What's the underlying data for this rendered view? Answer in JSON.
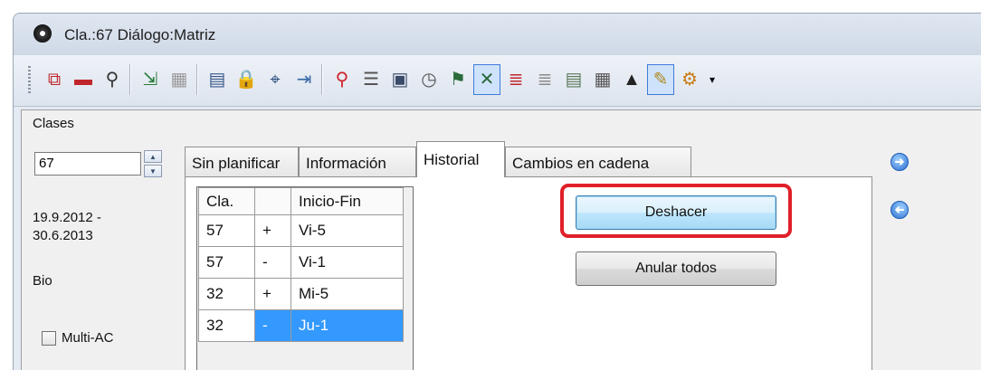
{
  "window": {
    "title": "Cla.:67  Diálogo:Matriz"
  },
  "toolbar": {
    "icons": [
      {
        "name": "copy-lesson-icon",
        "glyph": "⧉",
        "color": "#c0262b"
      },
      {
        "name": "lesson-icon",
        "glyph": "▬",
        "color": "#c0262b"
      },
      {
        "name": "split-icon",
        "glyph": "⚲",
        "color": "#333333"
      },
      {
        "name": "import-icon",
        "glyph": "⇲",
        "color": "#2a7a3b"
      },
      {
        "name": "grid-gray-icon",
        "glyph": "▦",
        "color": "#9a9a9a"
      },
      {
        "name": "teacher-icon",
        "glyph": "▤",
        "color": "#3a5a8a"
      },
      {
        "name": "lock-icon",
        "glyph": "🔒",
        "color": "#c98a1a"
      },
      {
        "name": "binoculars-icon",
        "glyph": "⌖",
        "color": "#2a4a7a"
      },
      {
        "name": "export-icon",
        "glyph": "⇥",
        "color": "#3a6aa8"
      },
      {
        "name": "pin-icon",
        "glyph": "⚲",
        "color": "#d0202a"
      },
      {
        "name": "list-filter-icon",
        "glyph": "☰",
        "color": "#555555"
      },
      {
        "name": "rooms-icon",
        "glyph": "▣",
        "color": "#3a4a6a"
      },
      {
        "name": "clock-icon",
        "glyph": "◷",
        "color": "#555555"
      },
      {
        "name": "graduate-icon",
        "glyph": "⚑",
        "color": "#2a6a3b"
      },
      {
        "name": "delete-lines-icon",
        "glyph": "✕",
        "color": "#2a6a3b"
      },
      {
        "name": "lines-red-icon",
        "glyph": "≣",
        "color": "#c0262b"
      },
      {
        "name": "lines-gray-icon",
        "glyph": "≣",
        "color": "#8a8a8a"
      },
      {
        "name": "table-edit-icon",
        "glyph": "▤",
        "color": "#5a7a5a"
      },
      {
        "name": "calculator-icon",
        "glyph": "▦",
        "color": "#555555"
      },
      {
        "name": "cap-icon",
        "glyph": "▲",
        "color": "#222222"
      },
      {
        "name": "palette-icon",
        "glyph": "✎",
        "color": "#b08a20"
      },
      {
        "name": "settings-gear-icon",
        "glyph": "⚙",
        "color": "#c87a10"
      }
    ],
    "more": "▾"
  },
  "sidebar": {
    "label": "Clases",
    "class_value": "67",
    "date_line1": "19.9.2012 -",
    "date_line2": "30.6.2013",
    "subject": "Bio",
    "multi_ac_label": "Multi-AC"
  },
  "tabs": [
    {
      "label": "Sin planificar",
      "active": false
    },
    {
      "label": "Información",
      "active": false
    },
    {
      "label": "Historial",
      "active": true
    },
    {
      "label": "Cambios en cadena",
      "active": false
    }
  ],
  "history": {
    "headers": [
      "Cla.",
      "",
      "Inicio-Fin"
    ],
    "rows": [
      [
        "57",
        "+",
        "Vi-5"
      ],
      [
        "57",
        "-",
        "Vi-1"
      ],
      [
        "32",
        "+",
        "Mi-5"
      ],
      [
        "32",
        "-",
        "Ju-1"
      ]
    ],
    "selected_row": 3
  },
  "buttons": {
    "undo": "Deshacer",
    "cancel_all": "Anular todos"
  }
}
